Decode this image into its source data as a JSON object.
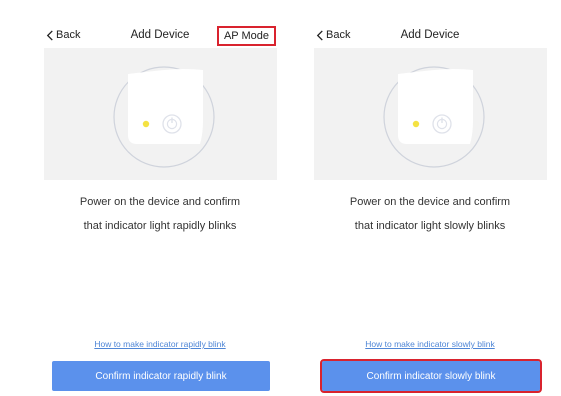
{
  "screens": [
    {
      "nav": {
        "back_label": "Back",
        "title": "Add Device",
        "mode_button": "AP Mode"
      },
      "instruction": {
        "line1": "Power on the device and confirm",
        "line2": "that indicator light rapidly blinks"
      },
      "help_link": "How to make indicator rapidly blink",
      "confirm_button": "Confirm indicator rapidly blink"
    },
    {
      "nav": {
        "back_label": "Back",
        "title": "Add Device"
      },
      "instruction": {
        "line1": "Power on the device and confirm",
        "line2": "that indicator light slowly blinks"
      },
      "help_link": "How to make indicator slowly blink",
      "confirm_button": "Confirm indicator slowly blink"
    }
  ],
  "colors": {
    "accent": "#5b91ec",
    "link": "#4f86d6",
    "indicator_led": "#f4e242",
    "highlight_box": "#d9232e",
    "illustration_bg": "#f2f2f2"
  },
  "icons": [
    "chevron-left-icon",
    "power-icon",
    "indicator-led-icon"
  ]
}
